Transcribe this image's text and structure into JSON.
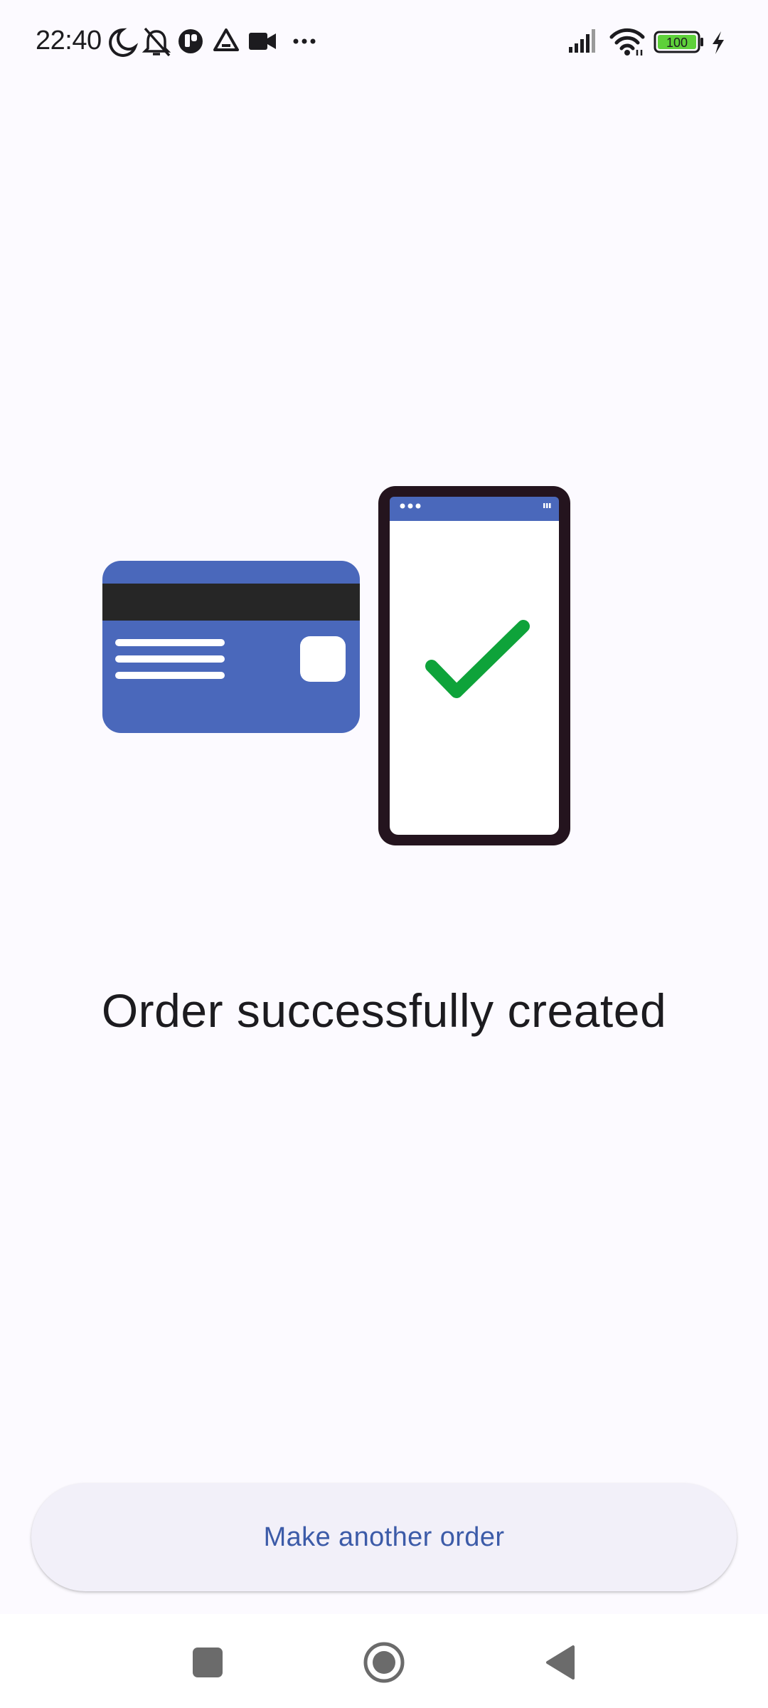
{
  "status_bar": {
    "time": "22:40",
    "battery_level": "100",
    "left_icons": [
      "moon-icon",
      "bell-off-icon",
      "app-badge-icon",
      "drive-icon",
      "video-camera-icon",
      "more-dots-icon"
    ],
    "right_icons": [
      "signal-icon",
      "wifi-icon",
      "battery-icon",
      "charging-icon"
    ]
  },
  "illustration": {
    "card_color": "#4a68bb",
    "stripe_color": "#262626",
    "phone_frame_color": "#24141e",
    "check_color": "#0ea33a"
  },
  "main": {
    "headline": "Order successfully created"
  },
  "actions": {
    "primary_label": "Make another order"
  },
  "nav_bar": {
    "buttons": [
      "recents-button",
      "home-button",
      "back-button"
    ]
  }
}
